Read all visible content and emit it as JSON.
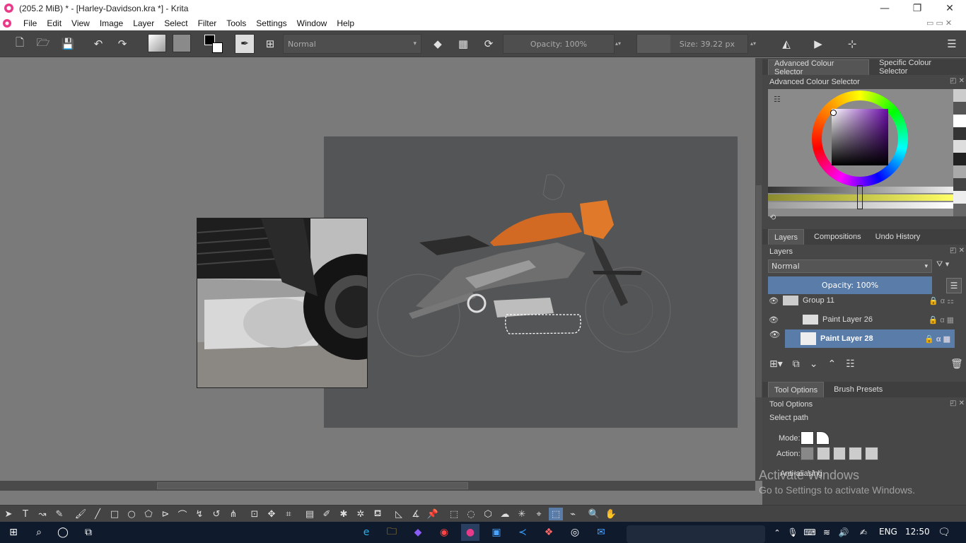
{
  "window": {
    "title": "(205.2 MiB)  * - [Harley-Davidson.kra *] - Krita",
    "minimize": "—",
    "restore": "❐",
    "close": "✕"
  },
  "menu": [
    "File",
    "Edit",
    "View",
    "Image",
    "Layer",
    "Select",
    "Filter",
    "Tools",
    "Settings",
    "Window",
    "Help"
  ],
  "toolbar": {
    "blend_mode": "Normal",
    "opacity": "Opacity: 100%",
    "size": "Size: 39.22 px"
  },
  "colour_panel": {
    "tabs": [
      "Advanced Colour Selector",
      "Specific Colour Selector"
    ],
    "title": "Advanced Colour Selector"
  },
  "layers_panel": {
    "tabs": [
      "Layers",
      "Compositions",
      "Undo History"
    ],
    "title": "Layers",
    "blend_mode": "Normal",
    "opacity": "Opacity:  100%",
    "layers": [
      {
        "name": "Group 11"
      },
      {
        "name": "Paint Layer 26"
      },
      {
        "name": "Paint Layer 28"
      }
    ]
  },
  "tool_options": {
    "tabs": [
      "Tool Options",
      "Brush Presets"
    ],
    "title": "Tool Options",
    "subtitle": "Select path",
    "mode_label": "Mode:",
    "action_label": "Action:",
    "antialiasing": "Anti-aliasing"
  },
  "watermark": {
    "line1": "Activate Windows",
    "line2": "Go to Settings to activate Windows."
  },
  "tray": {
    "lang": "ENG",
    "time": "12:50"
  }
}
